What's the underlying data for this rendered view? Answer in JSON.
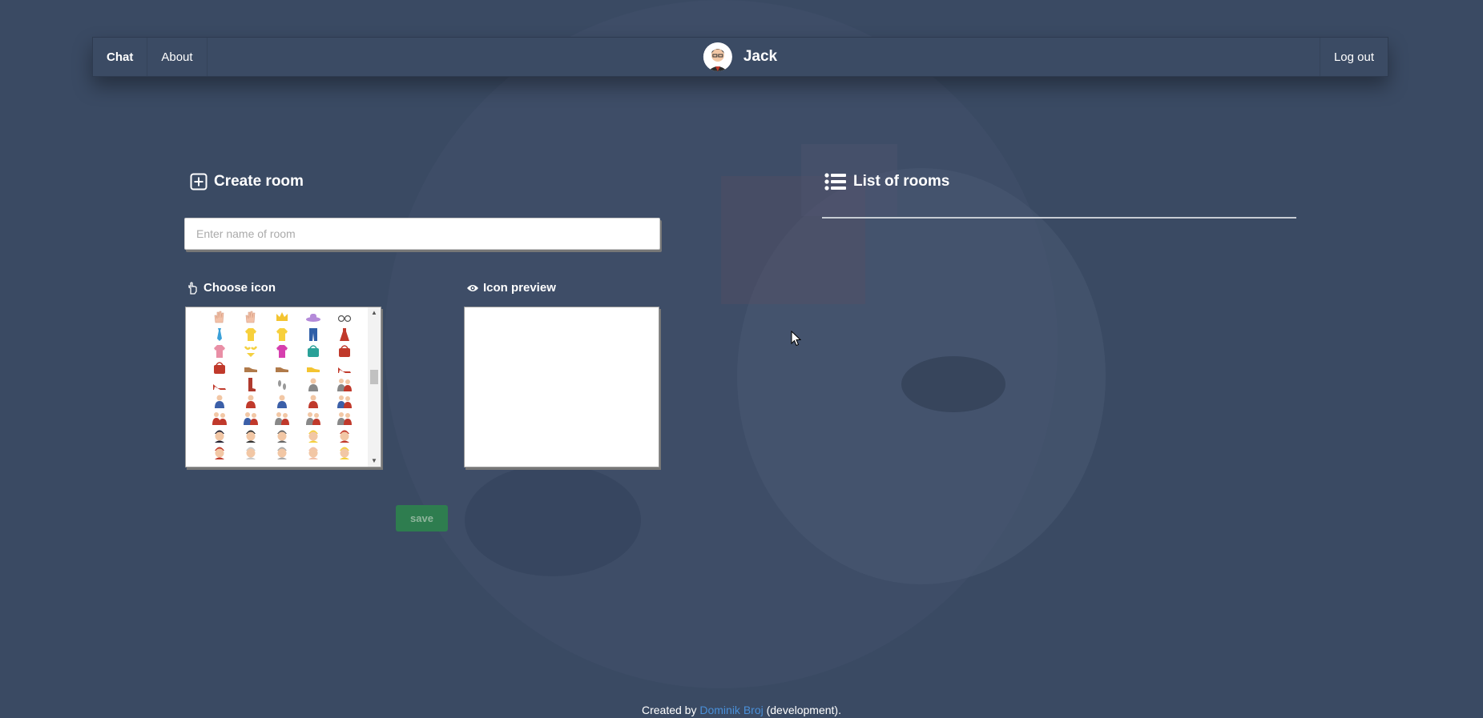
{
  "nav": {
    "links": [
      "Chat",
      "About"
    ],
    "username": "Jack",
    "logout_label": "Log out"
  },
  "create_room": {
    "title": "Create room",
    "input_placeholder": "Enter name of room",
    "input_value": "",
    "choose_icon_label": "Choose icon",
    "icon_preview_label": "Icon preview",
    "save_label": "save"
  },
  "rooms": {
    "title": "List of rooms",
    "items": []
  },
  "footer": {
    "prefix": "Created by ",
    "author": "Dominik Broj",
    "suffix": " (development)."
  },
  "icon_rows": [
    [
      "hand-icon",
      "raised-hands-icon",
      "crown-icon",
      "hat-icon",
      "eyeglasses-icon"
    ],
    [
      "necktie-icon",
      "tshirt-icon",
      "tshirt-icon",
      "jeans-icon",
      "dress-icon"
    ],
    [
      "kimono-icon",
      "bikini-icon",
      "blouse-icon",
      "purse-icon",
      "handbag-icon"
    ],
    [
      "pouch-icon",
      "shoe-icon",
      "shoe-icon",
      "sneaker-icon",
      "high-heel-icon"
    ],
    [
      "sandal-icon",
      "boot-icon",
      "footprints-icon",
      "silhouette-icon",
      "silhouettes-icon"
    ],
    [
      "boy-icon",
      "girl-icon",
      "man-icon",
      "woman-icon",
      "family-icon"
    ],
    [
      "couple-icon",
      "family-icon",
      "two-men-icon",
      "two-men-icon",
      "two-women-icon"
    ],
    [
      "police-icon",
      "bunny-girl-icon",
      "bride-icon",
      "blond-person-icon",
      "turban-man-icon"
    ],
    [
      "cap-man-icon",
      "old-man-icon",
      "old-woman-icon",
      "baby-icon",
      "princess-icon"
    ]
  ],
  "colors": {
    "background": "#3a4a63",
    "navbar": "#3b4b64",
    "save_button": "#2e7d4f",
    "link": "#4a90d9"
  }
}
